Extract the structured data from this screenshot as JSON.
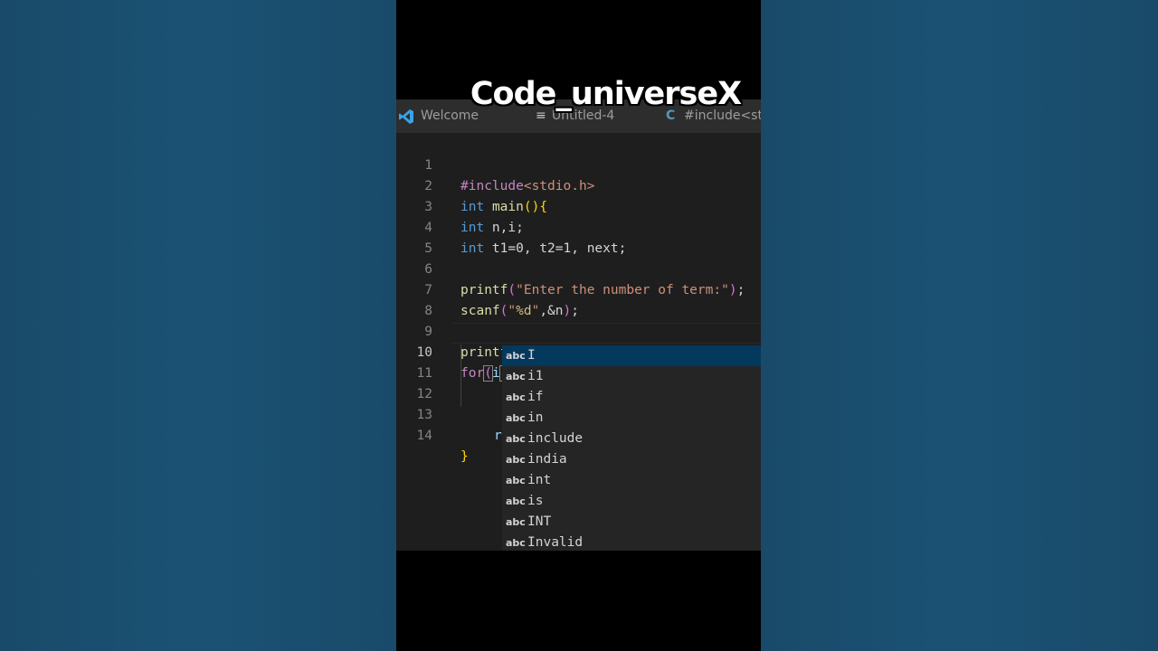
{
  "watermark": "Code_universeX",
  "tabs": [
    {
      "label": "Welcome",
      "icon": "vscode-icon"
    },
    {
      "label": "Untitled-4",
      "icon": "file-lines-icon"
    },
    {
      "label": "#include<std",
      "icon": "c-language-icon"
    }
  ],
  "line_numbers": [
    "1",
    "2",
    "3",
    "4",
    "5",
    "6",
    "7",
    "8",
    "9",
    "10",
    "11",
    "12",
    "13",
    "14"
  ],
  "code_lines": [
    "#include<stdio.h>",
    "int main(){",
    "int n,i;",
    "int t1=0, t2=1, next;",
    "",
    "printf(\"Enter the number of term:\");",
    "scanf(\"%d\",&n);",
    "",
    "printf(\"Fibonacci series:\");",
    "for(i)",
    "",
    "",
    "r",
    "}"
  ],
  "active_line": "10",
  "suggestions": {
    "kind_label": "abc",
    "items": [
      "I",
      "i1",
      "if",
      "in",
      "include",
      "india",
      "int",
      "is",
      "INT",
      "Invalid"
    ],
    "selected": "I"
  },
  "colors": {
    "background": "#1a4d6e",
    "editor_bg": "#1e1e1e",
    "keyword": "#569cd6",
    "string": "#ce9178",
    "function": "#dcdcaa",
    "suggest_selected": "#04395e"
  }
}
